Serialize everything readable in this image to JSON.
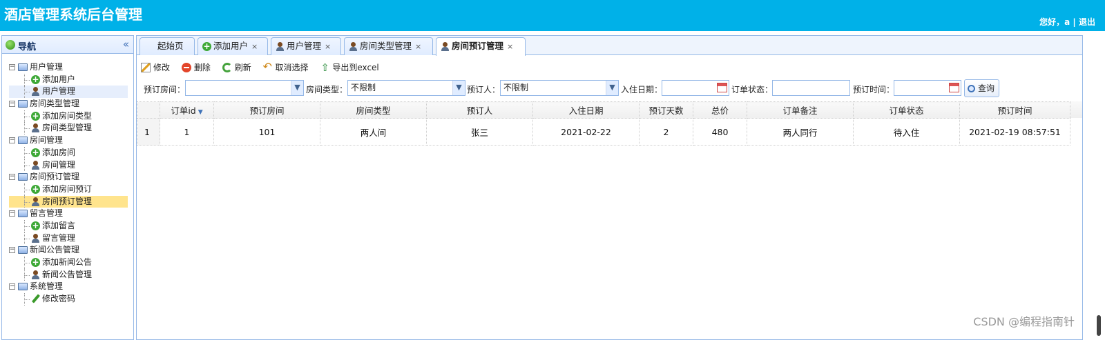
{
  "header": {
    "title": "酒店管理系统后台管理",
    "greeting": "您好，a",
    "separator": "|",
    "logout": "退出"
  },
  "sidebar": {
    "title": "导航",
    "collapse_icon": "«",
    "groups": [
      {
        "label": "用户管理",
        "items": [
          {
            "label": "添加用户",
            "icon": "add-icon"
          },
          {
            "label": "用户管理",
            "icon": "user-icon"
          }
        ]
      },
      {
        "label": "房间类型管理",
        "items": [
          {
            "label": "添加房间类型",
            "icon": "add-icon"
          },
          {
            "label": "房间类型管理",
            "icon": "user-icon"
          }
        ]
      },
      {
        "label": "房间管理",
        "items": [
          {
            "label": "添加房间",
            "icon": "add-icon"
          },
          {
            "label": "房间管理",
            "icon": "user-icon"
          }
        ]
      },
      {
        "label": "房间预订管理",
        "items": [
          {
            "label": "添加房间预订",
            "icon": "add-icon"
          },
          {
            "label": "房间预订管理",
            "icon": "user-icon"
          }
        ]
      },
      {
        "label": "留言管理",
        "items": [
          {
            "label": "添加留言",
            "icon": "add-icon"
          },
          {
            "label": "留言管理",
            "icon": "user-icon"
          }
        ]
      },
      {
        "label": "新闻公告管理",
        "items": [
          {
            "label": "添加新闻公告",
            "icon": "add-icon"
          },
          {
            "label": "新闻公告管理",
            "icon": "user-icon"
          }
        ]
      },
      {
        "label": "系统管理",
        "items": [
          {
            "label": "修改密码",
            "icon": "pencil-icon"
          }
        ]
      }
    ]
  },
  "tabs": [
    {
      "label": "起始页",
      "closable": false
    },
    {
      "label": "添加用户",
      "closable": true
    },
    {
      "label": "用户管理",
      "closable": true
    },
    {
      "label": "房间类型管理",
      "closable": true
    },
    {
      "label": "房间预订管理",
      "closable": true,
      "active": true
    }
  ],
  "tab_close_symbol": "×",
  "toolbar": {
    "edit": "修改",
    "delete": "删除",
    "refresh": "刷新",
    "unselect": "取消选择",
    "export": "导出到excel"
  },
  "search": {
    "room_label": "预订房间：",
    "room_value": "",
    "type_label": "房间类型：",
    "type_value": "不限制",
    "person_label": "预订人：",
    "person_value": "不限制",
    "checkin_label": "入住日期：",
    "checkin_value": "",
    "status_label": "订单状态：",
    "status_value": "",
    "time_label": "预订时间：",
    "time_value": "",
    "query_button": "查询"
  },
  "grid": {
    "columns": [
      "订单id",
      "预订房间",
      "房间类型",
      "预订人",
      "入住日期",
      "预订天数",
      "总价",
      "订单备注",
      "订单状态",
      "预订时间"
    ],
    "rows": [
      {
        "rownum": "1",
        "cells": [
          "1",
          "101",
          "两人间",
          "张三",
          "2021-02-22",
          "2",
          "480",
          "两人同行",
          "待入住",
          "2021-02-19 08:57:51"
        ]
      }
    ]
  },
  "watermark": "CSDN @编程指南针"
}
